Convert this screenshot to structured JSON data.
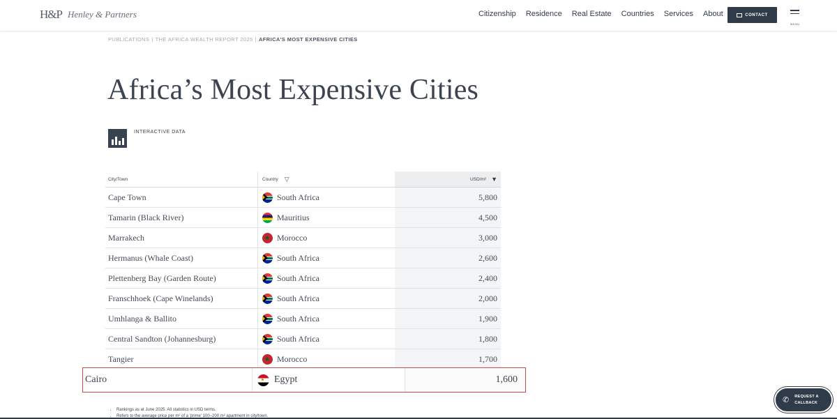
{
  "header": {
    "logo_mark": "H&P",
    "logo_text": "Henley & Partners",
    "nav": [
      "Citizenship",
      "Residence",
      "Real Estate",
      "Countries",
      "Services",
      "About"
    ],
    "contact_label": "CONTACT",
    "menu_label": "MENU"
  },
  "breadcrumb": {
    "items": [
      "PUBLICATIONS",
      "THE AFRICA WEALTH REPORT 2025"
    ],
    "current": "AFRICA'S MOST EXPENSIVE CITIES"
  },
  "title": "Africa’s Most Expensive Cities",
  "interactive_label": "INTERACTIVE DATA",
  "table": {
    "headers": {
      "city": "City/Town",
      "country": "Country",
      "usd": "USD/m²"
    },
    "rows": [
      {
        "city": "Cape Town",
        "country": "South Africa",
        "flag": "za",
        "value": "5,800"
      },
      {
        "city": "Tamarin (Black River)",
        "country": "Mauritius",
        "flag": "mu",
        "value": "4,500"
      },
      {
        "city": "Marrakech",
        "country": "Morocco",
        "flag": "ma",
        "value": "3,000"
      },
      {
        "city": "Hermanus (Whale Coast)",
        "country": "South Africa",
        "flag": "za",
        "value": "2,600"
      },
      {
        "city": "Plettenberg Bay (Garden Route)",
        "country": "South Africa",
        "flag": "za",
        "value": "2,400"
      },
      {
        "city": "Franschhoek (Cape Winelands)",
        "country": "South Africa",
        "flag": "za",
        "value": "2,000"
      },
      {
        "city": "Umhlanga & Ballito",
        "country": "South Africa",
        "flag": "za",
        "value": "1,900"
      },
      {
        "city": "Central Sandton (Johannesburg)",
        "country": "South Africa",
        "flag": "za",
        "value": "1,800"
      },
      {
        "city": "Tangier",
        "country": "Morocco",
        "flag": "ma",
        "value": "1,700"
      }
    ],
    "highlight": {
      "city": "Cairo",
      "country": "Egypt",
      "flag": "eg",
      "value": "1,600"
    }
  },
  "notes": [
    "Rankings as at June 2025. All statistics in USD terms.",
    "Refers to the average price per m² of a 'prime' 100–200 m² apartment in city/town."
  ],
  "callback": {
    "line1": "REQUEST A",
    "line2": "CALLBACK"
  },
  "colors": {
    "accent": "#2f3b48",
    "highlight_border": "#c84a4a"
  }
}
